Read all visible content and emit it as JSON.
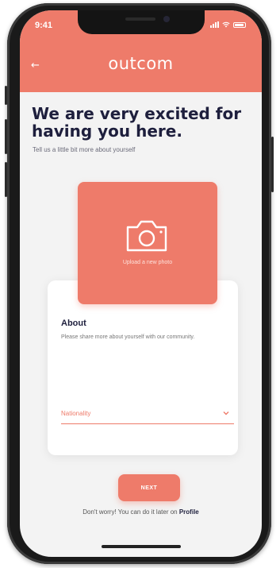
{
  "status_bar": {
    "time": "9:41"
  },
  "header": {
    "back_icon": "back-arrow-icon",
    "brand": "outcom",
    "color": "#ee7b6a"
  },
  "intro": {
    "heading": "We are very excited for having you here.",
    "subheading": "Tell us a little bit more about yourself"
  },
  "photo": {
    "icon": "camera-icon",
    "label": "Upload a new photo"
  },
  "about": {
    "title": "About",
    "description": "Please share more about yourself with our community."
  },
  "nationality": {
    "selected": "Nationality",
    "icon": "chevron-down-icon"
  },
  "actions": {
    "next_label": "NEXT",
    "note_prefix": "Don't worry! You can do it later on",
    "note_link": "Profile"
  },
  "colors": {
    "accent": "#ee7b6a",
    "heading": "#1e1f3d",
    "background": "#f3f3f3"
  }
}
